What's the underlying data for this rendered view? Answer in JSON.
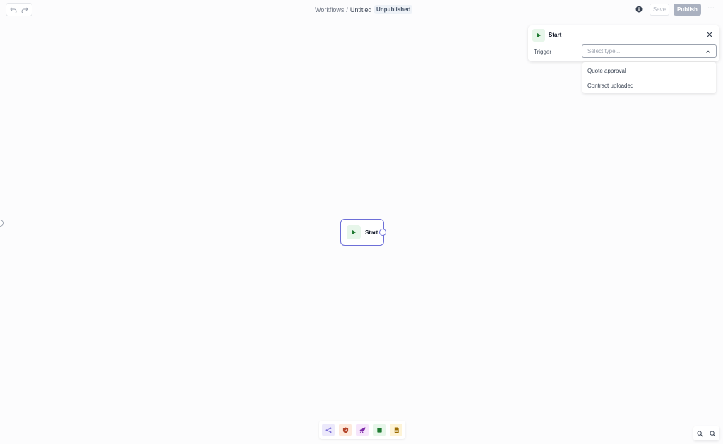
{
  "header": {
    "breadcrumb_root": "Workflows",
    "breadcrumb_sep": "/",
    "breadcrumb_current": "Untitled",
    "status_badge": "Unpublished",
    "save_label": "Save",
    "publish_label": "Publish",
    "more_label": "···"
  },
  "panel": {
    "title": "Start",
    "trigger_label": "Trigger",
    "select_placeholder": "Select type...",
    "options": [
      "Quote approval",
      "Contract uploaded"
    ]
  },
  "node": {
    "label": "Start"
  },
  "toolbar": {
    "tools": [
      {
        "icon": "share-nodes-icon",
        "bg": "#ece9fb",
        "fg": "#7c6fd8"
      },
      {
        "icon": "shield-icon",
        "bg": "#fde9dc",
        "fg": "#b4452a"
      },
      {
        "icon": "rocket-icon",
        "bg": "#f6e6fb",
        "fg": "#7d2aa8"
      },
      {
        "icon": "stop-square-icon",
        "bg": "#e7f6ea",
        "fg": "#1f7a32"
      },
      {
        "icon": "document-icon",
        "bg": "#fdf3d6",
        "fg": "#9a6a00"
      }
    ]
  },
  "colors": {
    "accent": "#6d6fd8",
    "start_green": "#1f7a32",
    "publish_bg": "#aab1c0"
  }
}
